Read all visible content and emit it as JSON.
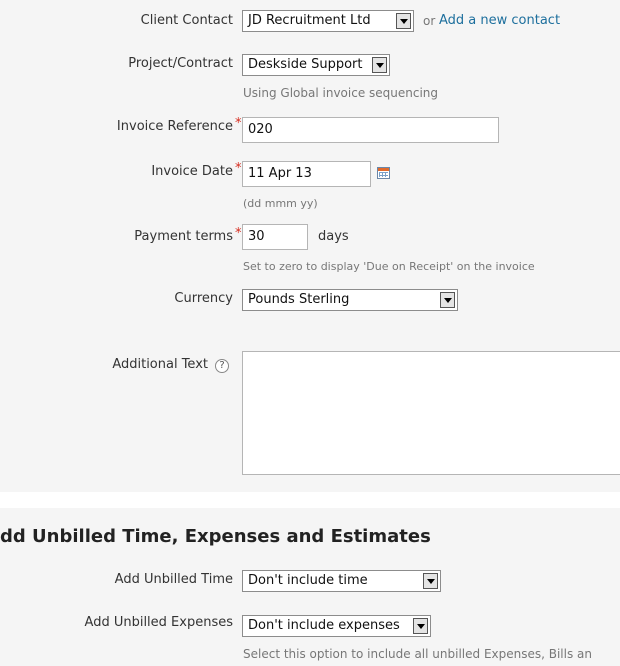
{
  "form": {
    "client_contact": {
      "label": "Client Contact",
      "value": "JD Recruitment Ltd",
      "or_text": "or",
      "add_link": "Add a new contact"
    },
    "project_contract": {
      "label": "Project/Contract",
      "value": "Deskside Support",
      "hint": "Using Global invoice sequencing"
    },
    "invoice_reference": {
      "label": "Invoice Reference",
      "required_mark": "*",
      "value": "020"
    },
    "invoice_date": {
      "label": "Invoice Date",
      "required_mark": "*",
      "value": "11 Apr 13",
      "hint": "(dd mmm yy)",
      "icon": "calendar-icon"
    },
    "payment_terms": {
      "label": "Payment terms",
      "required_mark": "*",
      "value": "30",
      "unit": "days",
      "hint": "Set to zero to display 'Due on Receipt' on the invoice"
    },
    "currency": {
      "label": "Currency",
      "value": "Pounds Sterling"
    },
    "additional_text": {
      "label": "Additional Text",
      "help_icon": "?",
      "value": ""
    }
  },
  "unbilled_section": {
    "title": "dd Unbilled Time, Expenses and Estimates",
    "add_unbilled_time": {
      "label": "Add Unbilled Time",
      "value": "Don't include time"
    },
    "add_unbilled_expenses": {
      "label": "Add Unbilled Expenses",
      "value": "Don't include expenses",
      "hint": "Select this option to include all unbilled Expenses, Bills an"
    }
  }
}
